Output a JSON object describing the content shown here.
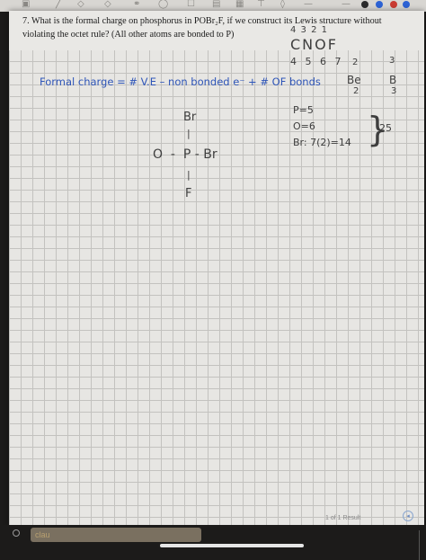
{
  "question": {
    "number": "7.",
    "text": "What is the formal charge on phosphorus in POBr₂F, if we construct its Lewis structure without violating the octet rule? (All other atoms are bonded to P)"
  },
  "notes": {
    "ranks_top": "4 3 2 1",
    "elements_top": "CNOF",
    "ranks_bottom": "4 5 6 7",
    "be_group": "2",
    "b_group": "3",
    "formula": "Formal charge = # V.E – non bonded e⁻ + # OF bonds",
    "be_label": "Be",
    "be_valence": "2",
    "b_label": "B",
    "b_valence": "3",
    "structure": {
      "top": "Br",
      "bond_top": "|",
      "middle": "O  -  P - Br",
      "bond_bottom": "|",
      "bottom": "F"
    },
    "counts": [
      "P=5",
      "O=6",
      "Br: 7(2)=14"
    ],
    "total": "25"
  },
  "footer": {
    "status": "1 of 1 Result",
    "answer_value": "clau"
  },
  "colors": {
    "ink_blue": "#2e55b8",
    "ink_dark": "#3e3e3e",
    "paper": "#e7e6e3"
  }
}
